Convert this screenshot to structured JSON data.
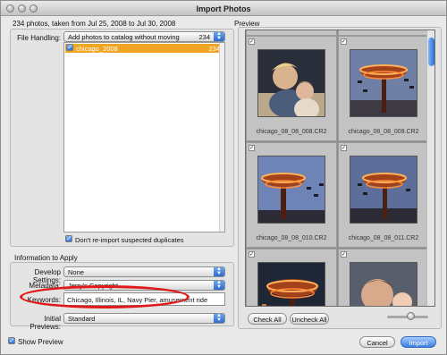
{
  "window": {
    "title": "Import Photos"
  },
  "summary": "234 photos, taken from Jul 25, 2008 to Jul 30, 2008",
  "file_handling": {
    "label": "File Handling:",
    "value": "Add photos to catalog without moving",
    "count": "234"
  },
  "source_list": [
    {
      "name": "chicago_2008",
      "count": "234",
      "checked": true
    }
  ],
  "dont_reimport": {
    "label": "Don't re-import suspected duplicates",
    "checked": true
  },
  "info_section": {
    "title": "Information to Apply",
    "develop_settings": {
      "label": "Develop Settings:",
      "value": "None"
    },
    "metadata": {
      "label": "Metadata:",
      "value": "Jerry's Copyright"
    },
    "keywords": {
      "label": "Keywords:",
      "value": "Chicago, Illinois, IL, Navy Pier, amusement ride"
    },
    "initial_previews": {
      "label": "Initial Previews:",
      "value": "Standard"
    }
  },
  "show_preview": {
    "label": "Show Preview",
    "checked": true
  },
  "preview": {
    "title": "Preview",
    "photos": [
      {
        "caption": "chicago_08_08_008.CR2",
        "subject": "family",
        "checked": true
      },
      {
        "caption": "chicago_08_08_009.CR2",
        "subject": "swing-ride",
        "checked": true
      },
      {
        "caption": "chicago_08_08_010.CR2",
        "subject": "swing-ride",
        "checked": true
      },
      {
        "caption": "chicago_08_08_011.CR2",
        "subject": "swing-ride",
        "checked": true
      },
      {
        "caption": "",
        "subject": "swing-ride",
        "checked": true
      },
      {
        "caption": "",
        "subject": "family",
        "checked": true
      }
    ],
    "check_all_label": "Check All",
    "uncheck_all_label": "Uncheck All"
  },
  "buttons": {
    "cancel": "Cancel",
    "import": "Import"
  },
  "colors": {
    "selection": "#f1a522",
    "annotation": "#e01a1a",
    "accent": "#2f6fd3"
  },
  "icons": {
    "checkbox": "checkmark-icon",
    "popup": "updown-arrows-icon"
  }
}
